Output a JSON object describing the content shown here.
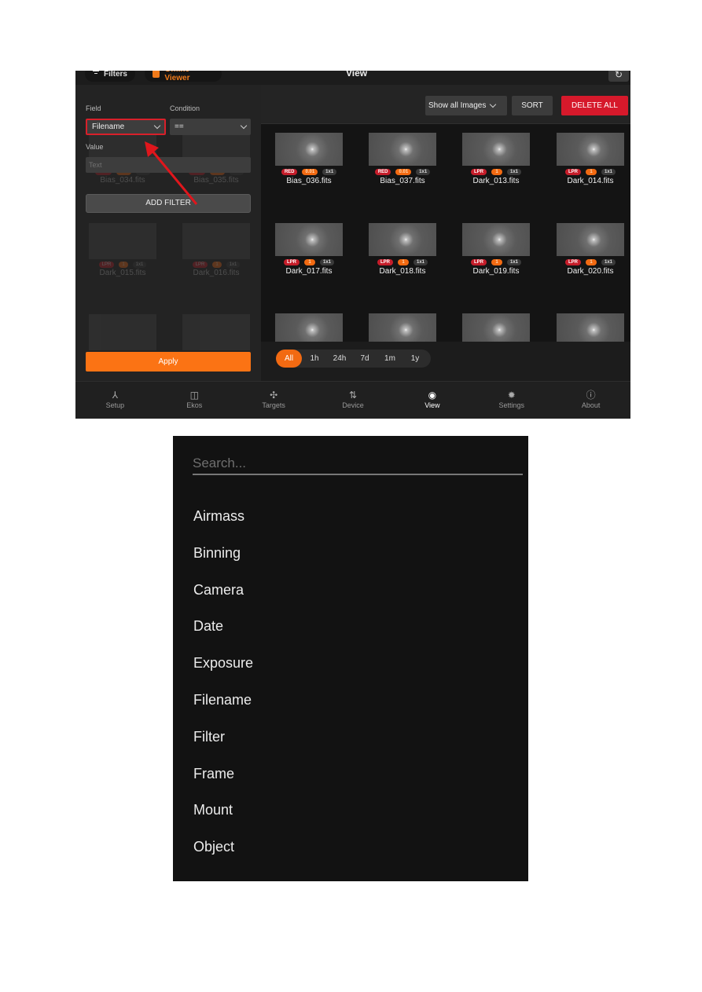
{
  "app": {
    "top_buttons": {
      "filters": "Filters",
      "offline_viewer": "Offline Viewer"
    },
    "title": "View",
    "refresh_icon": "↻",
    "filter_panel": {
      "field_label": "Field",
      "field_value": "Filename",
      "condition_label": "Condition",
      "condition_value": "==",
      "value_label": "Value",
      "value_placeholder": "Text",
      "add_filter_label": "ADD FILTER",
      "apply_label": "Apply",
      "ghost_cards": [
        {
          "name": "Bias_034.fits",
          "badges": [
            "RED",
            "0.01",
            "1x1"
          ]
        },
        {
          "name": "Bias_035.fits",
          "badges": [
            "RED",
            "0.01",
            "1x1"
          ]
        },
        {
          "name": "Dark_015.fits",
          "badges": [
            "LPR",
            "1",
            "1x1"
          ]
        },
        {
          "name": "Dark_016.fits",
          "badges": [
            "LPR",
            "1",
            "1x1"
          ]
        }
      ]
    },
    "toolbar": {
      "show_select": "Show all Images",
      "sort_label": "SORT",
      "delete_all_label": "DELETE ALL"
    },
    "images": [
      {
        "name": "Bias_036.fits",
        "filter": "RED",
        "exposure": "0.01",
        "binning": "1x1"
      },
      {
        "name": "Bias_037.fits",
        "filter": "RED",
        "exposure": "0.01",
        "binning": "1x1"
      },
      {
        "name": "Dark_013.fits",
        "filter": "LPR",
        "exposure": "1",
        "binning": "1x1"
      },
      {
        "name": "Dark_014.fits",
        "filter": "LPR",
        "exposure": "1",
        "binning": "1x1"
      },
      {
        "name": "Dark_017.fits",
        "filter": "LPR",
        "exposure": "1",
        "binning": "1x1"
      },
      {
        "name": "Dark_018.fits",
        "filter": "LPR",
        "exposure": "1",
        "binning": "1x1"
      },
      {
        "name": "Dark_019.fits",
        "filter": "LPR",
        "exposure": "1",
        "binning": "1x1"
      },
      {
        "name": "Dark_020.fits",
        "filter": "LPR",
        "exposure": "1",
        "binning": "1x1"
      },
      {
        "name": "",
        "filter": "",
        "exposure": "",
        "binning": ""
      },
      {
        "name": "",
        "filter": "",
        "exposure": "",
        "binning": ""
      },
      {
        "name": "",
        "filter": "",
        "exposure": "",
        "binning": ""
      },
      {
        "name": "",
        "filter": "",
        "exposure": "",
        "binning": ""
      }
    ],
    "time_filters": [
      "All",
      "1h",
      "24h",
      "7d",
      "1m",
      "1y"
    ],
    "time_filter_active": "All",
    "nav": [
      {
        "label": "Setup",
        "icon": "⅄"
      },
      {
        "label": "Ekos",
        "icon": "◫"
      },
      {
        "label": "Targets",
        "icon": "✣"
      },
      {
        "label": "Device",
        "icon": "⇅"
      },
      {
        "label": "View",
        "icon": "◉"
      },
      {
        "label": "Settings",
        "icon": "✹"
      },
      {
        "label": "About",
        "icon": "ⓘ"
      }
    ],
    "nav_active": "View",
    "colors": {
      "accent": "#fb7314",
      "danger": "#d6192b",
      "highlight_border": "#d8202a"
    }
  },
  "picker": {
    "search_placeholder": "Search...",
    "options": [
      "Airmass",
      "Binning",
      "Camera",
      "Date",
      "Exposure",
      "Filename",
      "Filter",
      "Frame",
      "Mount",
      "Object"
    ]
  }
}
